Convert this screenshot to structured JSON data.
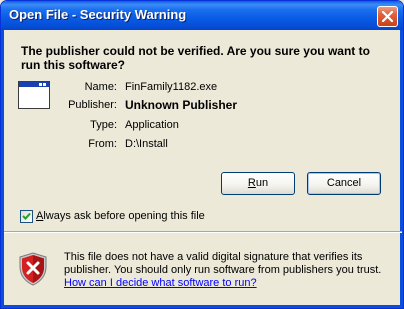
{
  "window": {
    "title": "Open File - Security Warning",
    "close_icon": "close-icon"
  },
  "warning": {
    "text": "The publisher could not be verified.  Are you sure you want to run this software?"
  },
  "details": {
    "name_label": "Name:",
    "name_value": "FinFamily1182.exe",
    "publisher_label": "Publisher:",
    "publisher_value": "Unknown Publisher",
    "type_label": "Type:",
    "type_value": "Application",
    "from_label": "From:",
    "from_value": "D:\\Install"
  },
  "buttons": {
    "run_label_mnemonic": "R",
    "run_label_rest": "un",
    "cancel_label": "Cancel"
  },
  "checkbox": {
    "checked": true,
    "label_mnemonic": "A",
    "label_rest": "lways ask before opening this file"
  },
  "footer": {
    "text": "This file does not have a valid digital signature that verifies its publisher.  You should only run software from publishers you trust.",
    "link": "How can I decide what software to run?"
  },
  "colors": {
    "titlebar": "#0a5be4",
    "dialog_bg": "#ece9d8",
    "close_button": "#e0613c",
    "shield_red": "#d42020",
    "link": "#0000ff"
  }
}
